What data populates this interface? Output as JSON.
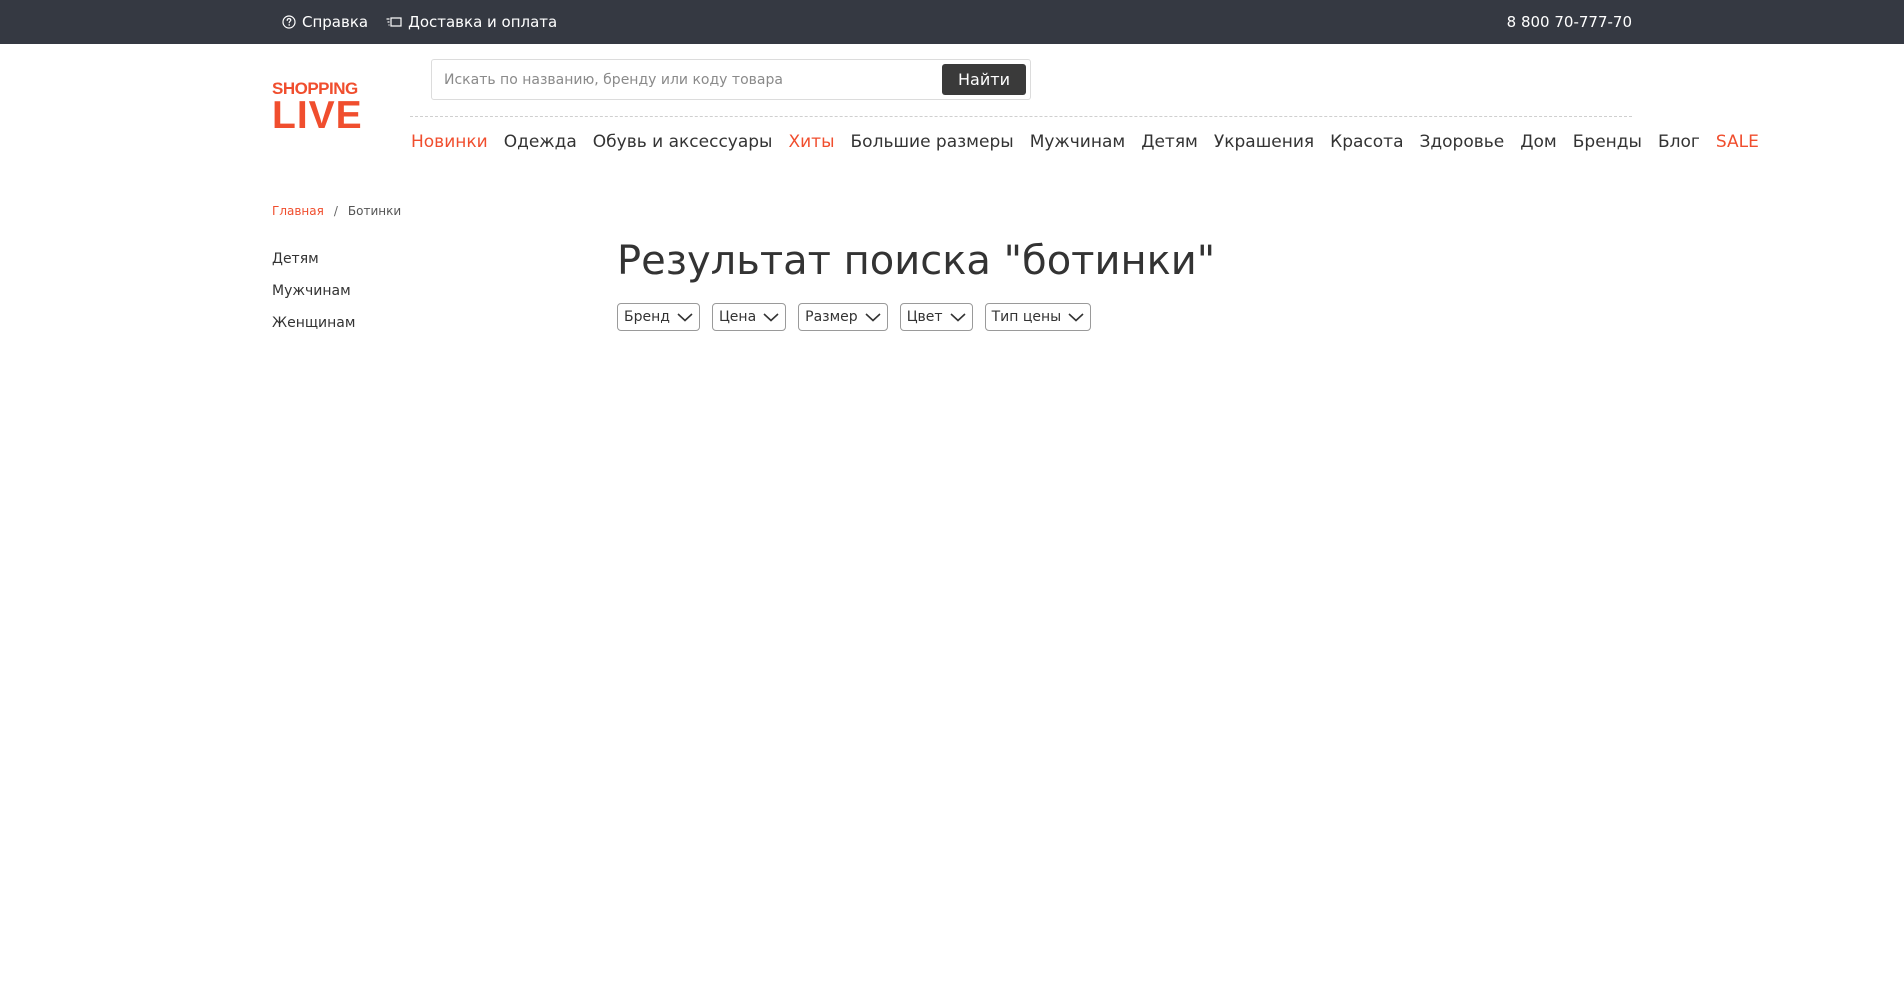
{
  "topbar": {
    "help_label": "Справка",
    "help_icon": "question-circle-icon",
    "delivery_label": "Доставка и оплата",
    "delivery_icon": "delivery-truck-icon",
    "phone": "8 800 70-777-70"
  },
  "logo": {
    "line1": "SHOPPING",
    "line2": "LIVE",
    "color": "#f04e2e"
  },
  "search": {
    "placeholder": "Искать по названию, бренду или коду товара",
    "value": "",
    "button_label": "Найти"
  },
  "nav": {
    "items": [
      {
        "label": "Новинки",
        "accent": true
      },
      {
        "label": "Одежда",
        "accent": false
      },
      {
        "label": "Обувь и аксессуары",
        "accent": false
      },
      {
        "label": "Хиты",
        "accent": true
      },
      {
        "label": "Большие размеры",
        "accent": false
      },
      {
        "label": "Мужчинам",
        "accent": false
      },
      {
        "label": "Детям",
        "accent": false
      },
      {
        "label": "Украшения",
        "accent": false
      },
      {
        "label": "Красота",
        "accent": false
      },
      {
        "label": "Здоровье",
        "accent": false
      },
      {
        "label": "Дом",
        "accent": false
      },
      {
        "label": "Бренды",
        "accent": false
      },
      {
        "label": "Блог",
        "accent": false
      },
      {
        "label": "SALE",
        "accent": true
      }
    ]
  },
  "breadcrumb": {
    "home": "Главная",
    "separator": "/",
    "current": "Ботинки"
  },
  "sidebar": {
    "items": [
      "Детям",
      "Мужчинам",
      "Женщинам"
    ]
  },
  "main": {
    "title": "Результат поиска \"ботинки\"",
    "filters": [
      "Бренд",
      "Цена",
      "Размер",
      "Цвет",
      "Тип цены"
    ]
  },
  "colors": {
    "topbar_bg": "#353942",
    "accent": "#f04e2e",
    "button_bg": "#3a3a3a",
    "text": "#333333"
  }
}
